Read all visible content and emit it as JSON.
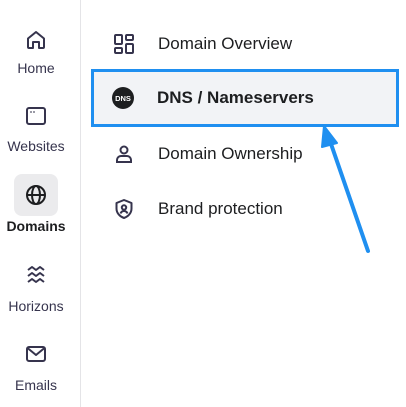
{
  "sidebar": {
    "items": [
      {
        "label": "Home",
        "icon": "home-icon"
      },
      {
        "label": "Websites",
        "icon": "browser-window-icon"
      },
      {
        "label": "Domains",
        "icon": "globe-icon",
        "active": true
      },
      {
        "label": "Horizons",
        "icon": "horizons-icon"
      },
      {
        "label": "Emails",
        "icon": "envelope-icon"
      }
    ]
  },
  "submenu": {
    "items": [
      {
        "label": "Domain Overview",
        "icon": "grid-icon"
      },
      {
        "label": "DNS / Nameservers",
        "icon": "dns-icon",
        "icon_text": "DNS",
        "active": true
      },
      {
        "label": "Domain Ownership",
        "icon": "user-icon"
      },
      {
        "label": "Brand protection",
        "icon": "shield-icon"
      }
    ]
  },
  "annotation": {
    "arrow_color": "#1f8ff0",
    "highlight_color": "#1f8ff0"
  }
}
